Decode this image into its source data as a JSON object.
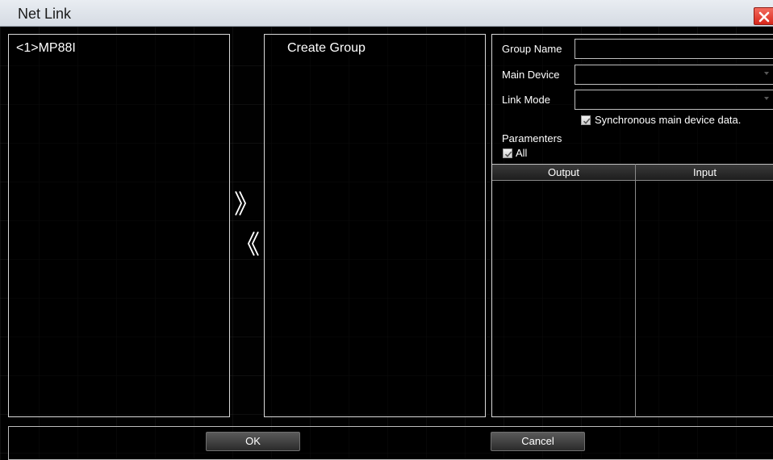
{
  "window": {
    "title": "Net Link"
  },
  "device_list": {
    "items": [
      "<1>MP88I"
    ]
  },
  "group_list": {
    "items": [
      "Create Group"
    ]
  },
  "transfer": {
    "add_symbol": "》",
    "remove_symbol": "《"
  },
  "settings": {
    "group_name_label": "Group Name",
    "group_name_value": "",
    "main_device_label": "Main Device",
    "main_device_value": "",
    "link_mode_label": "Link Mode",
    "link_mode_value": "",
    "sync_label": "Synchronous main device data.",
    "sync_checked": true,
    "parameters_label": "Paramenters",
    "all_label": "All",
    "all_checked": true,
    "table": {
      "columns": [
        "Output",
        "Input"
      ],
      "rows": []
    }
  },
  "buttons": {
    "ok": "OK",
    "cancel": "Cancel"
  },
  "colors": {
    "close_button": "#e0392b",
    "background": "#000000"
  }
}
